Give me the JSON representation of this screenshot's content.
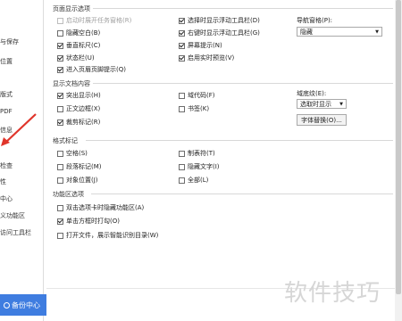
{
  "sidebar": {
    "items": [
      "与保存",
      "位置",
      "版式",
      "PDF",
      "信息",
      "检查",
      "性",
      "中心",
      "义功能区",
      "访问工具栏"
    ],
    "backup_label": "备份中心"
  },
  "page_display": {
    "title": "页面显示选项",
    "left": [
      {
        "label": "启动时展开任务窗格(R)",
        "checked": false,
        "disabled": true
      },
      {
        "label": "隐藏空白(B)",
        "checked": false,
        "disabled": false
      },
      {
        "label": "垂直标尺(C)",
        "checked": true,
        "disabled": false
      },
      {
        "label": "状态栏(U)",
        "checked": true,
        "disabled": false
      },
      {
        "label": "进入页眉页脚提示(Q)",
        "checked": true,
        "disabled": false
      }
    ],
    "middle": [
      {
        "label": "选择时显示浮动工具栏(D)",
        "checked": true
      },
      {
        "label": "右键时显示浮动工具栏(G)",
        "checked": true
      },
      {
        "label": "屏幕提示(N)",
        "checked": true
      },
      {
        "label": "启用实时预览(V)",
        "checked": true
      }
    ],
    "nav_pane_label": "导航窗格(P):",
    "nav_pane_value": "隐藏"
  },
  "show_content": {
    "title": "显示文档内容",
    "left": [
      {
        "label": "突出显示(H)",
        "checked": true
      },
      {
        "label": "正文边框(X)",
        "checked": false
      },
      {
        "label": "裁剪标记(R)",
        "checked": true
      }
    ],
    "middle": [
      {
        "label": "域代码(F)",
        "checked": false
      },
      {
        "label": "书签(K)",
        "checked": false
      }
    ],
    "field_shading_label": "域底纹(E):",
    "field_shading_value": "选取时显示",
    "font_substitution_button": "字体替换(O)..."
  },
  "format_marks": {
    "title": "格式标记",
    "left": [
      {
        "label": "空格(S)",
        "checked": false
      },
      {
        "label": "段落标记(M)",
        "checked": false
      },
      {
        "label": "对象位置(J)",
        "checked": false
      }
    ],
    "middle": [
      {
        "label": "制表符(T)",
        "checked": false
      },
      {
        "label": "隐藏文字(I)",
        "checked": false
      },
      {
        "label": "全部(L)",
        "checked": false
      }
    ]
  },
  "ribbon_options": {
    "title": "功能区选项",
    "items": [
      {
        "label": "双击选项卡时隐藏功能区(A)",
        "checked": false
      },
      {
        "label": "单击方框时打勾(O)",
        "checked": true
      },
      {
        "label": "打开文件，展示智能识别目录(W)",
        "checked": false
      }
    ]
  },
  "watermark": "软件技巧",
  "accent_color": "#3f7de0"
}
